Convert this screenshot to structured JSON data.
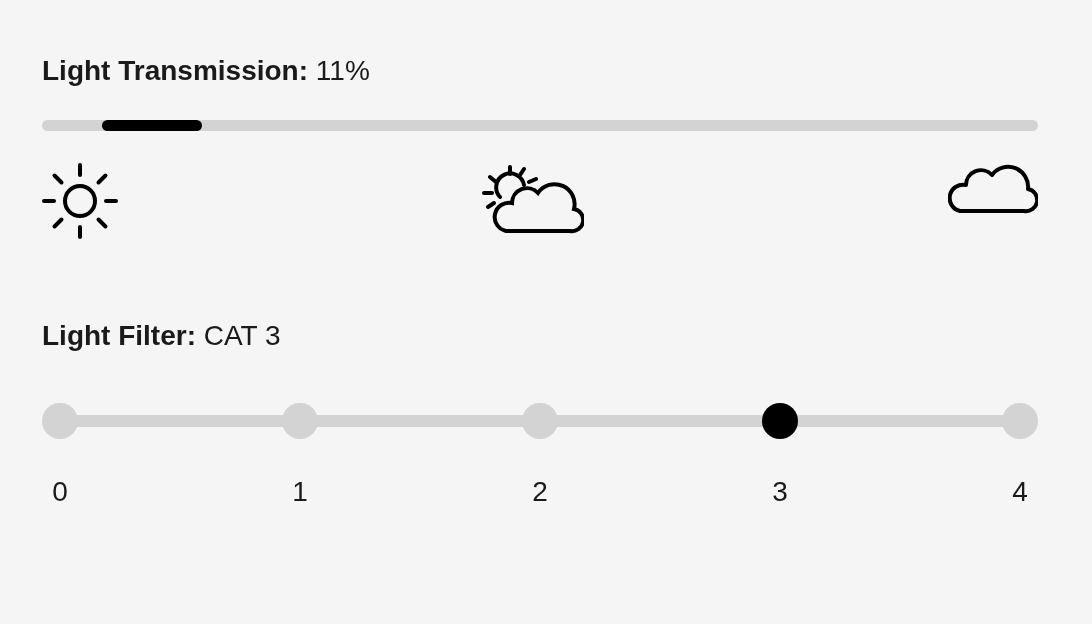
{
  "transmission": {
    "label": "Light Transmission:",
    "value": "11%",
    "level": 0.11
  },
  "filter": {
    "label": "Light Filter:",
    "value": "CAT 3",
    "steps": [
      {
        "label": "0",
        "selected": false
      },
      {
        "label": "1",
        "selected": false
      },
      {
        "label": "2",
        "selected": false
      },
      {
        "label": "3",
        "selected": true
      },
      {
        "label": "4",
        "selected": false
      }
    ]
  }
}
